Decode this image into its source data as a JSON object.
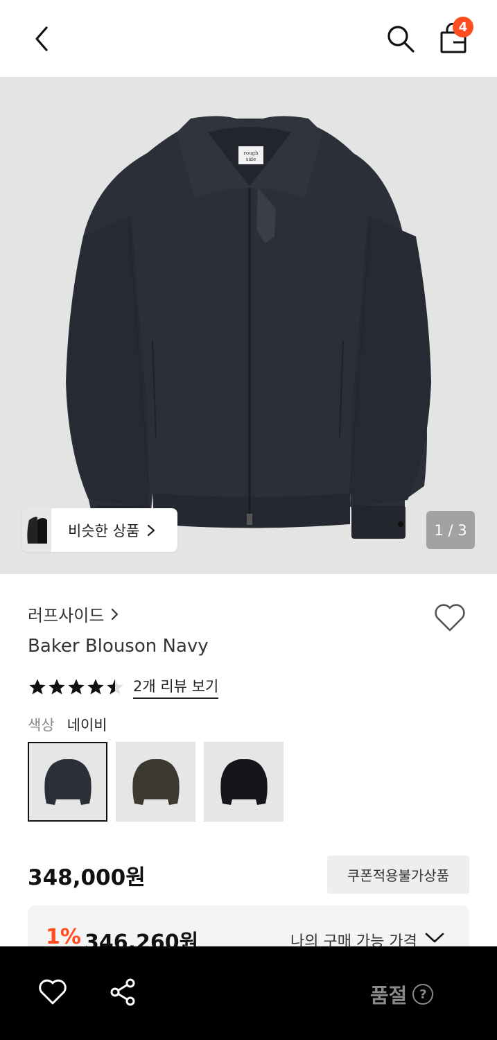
{
  "header": {
    "cart_count": "4"
  },
  "hero": {
    "similar_label": "비슷한 상품",
    "page_indicator": "1 / 3",
    "tag_text_1": "rough",
    "tag_text_2": "side"
  },
  "product": {
    "brand": "러프사이드",
    "name": "Baker Blouson Navy",
    "rating": 4.5,
    "review_link": "2개 리뷰 보기",
    "color_label": "색상",
    "color_value": "네이비",
    "swatches": [
      "navy",
      "olive",
      "black"
    ],
    "price": "348,000원",
    "coupon_button": "쿠폰적용불가상품"
  },
  "my_price": {
    "percent": "1%",
    "amount": "346,260원",
    "label": "나의 구매 가능 가격"
  },
  "bottom_bar": {
    "status": "품절",
    "help_glyph": "?"
  },
  "colors": {
    "accent": "#ff4d1f",
    "navy": "#2b2f38",
    "olive": "#3c3a30",
    "black": "#15161b"
  }
}
